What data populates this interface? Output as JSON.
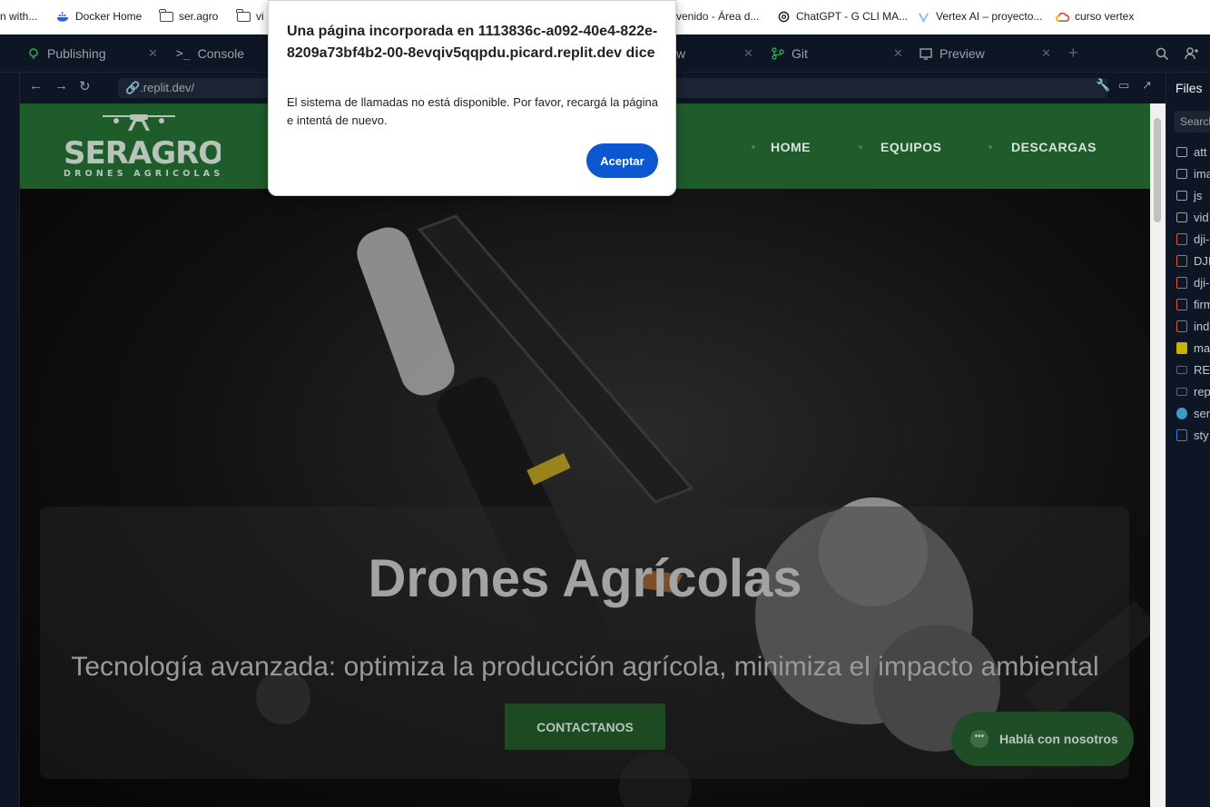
{
  "bookmarks": [
    {
      "label": "n with...",
      "icon": "none"
    },
    {
      "label": "Docker Home",
      "icon": "docker-icon"
    },
    {
      "label": "ser.agro",
      "icon": "folder-icon"
    },
    {
      "label": "vi",
      "icon": "folder-icon"
    },
    {
      "label": "venido - Área d...",
      "icon": "none"
    },
    {
      "label": "ChatGPT - G CLI MA...",
      "icon": "chatgpt-icon"
    },
    {
      "label": "Vertex AI – proyecto...",
      "icon": "vertex-icon"
    },
    {
      "label": "curso vertex",
      "icon": "google-icon"
    }
  ],
  "ide": {
    "tabs": [
      {
        "label": "Publishing",
        "icon": "publishing-icon"
      },
      {
        "label": "Console",
        "icon": "console-icon"
      },
      {
        "label": "w",
        "icon": "none"
      },
      {
        "label": "Git",
        "icon": "git-icon"
      },
      {
        "label": "Preview",
        "icon": "preview-icon"
      }
    ],
    "address": ".replit.dev/",
    "files_title": "Files",
    "files_search_placeholder": "Search",
    "files": [
      {
        "name": "att",
        "type": "folder"
      },
      {
        "name": "ima",
        "type": "folder"
      },
      {
        "name": "js",
        "type": "folder"
      },
      {
        "name": "vid",
        "type": "folder"
      },
      {
        "name": "dji-",
        "type": "html"
      },
      {
        "name": "DJI",
        "type": "html"
      },
      {
        "name": "dji-",
        "type": "html"
      },
      {
        "name": "firm",
        "type": "html"
      },
      {
        "name": "ind",
        "type": "html"
      },
      {
        "name": "ma",
        "type": "js"
      },
      {
        "name": "RE",
        "type": "md"
      },
      {
        "name": "rep",
        "type": "md"
      },
      {
        "name": "ser",
        "type": "py"
      },
      {
        "name": "sty",
        "type": "css"
      }
    ]
  },
  "site": {
    "logo_main": "SERAGRO",
    "logo_sub": "DRONES AGRICOLAS",
    "nav": [
      "HOME",
      "EQUIPOS",
      "DESCARGAS"
    ],
    "hero_title": "Drones Agrícolas",
    "hero_subtitle": "Tecnología avanzada: optimiza la producción agrícola, minimiza el impacto ambiental",
    "cta": "CONTACTANOS",
    "chat": "Hablá con nosotros",
    "colors": {
      "header": "#1f5c2c",
      "cta": "#1d4a22"
    }
  },
  "dialog": {
    "title": "Una página incorporada en 1113836c-a092-40e4-822e-8209a73bf4b2-00-8evqiv5qqpdu.picard.replit.dev dice",
    "message": "El sistema de llamadas no está disponible. Por favor, recargá la página e intentá de nuevo.",
    "button": "Aceptar",
    "accent": "#0b57d0"
  }
}
